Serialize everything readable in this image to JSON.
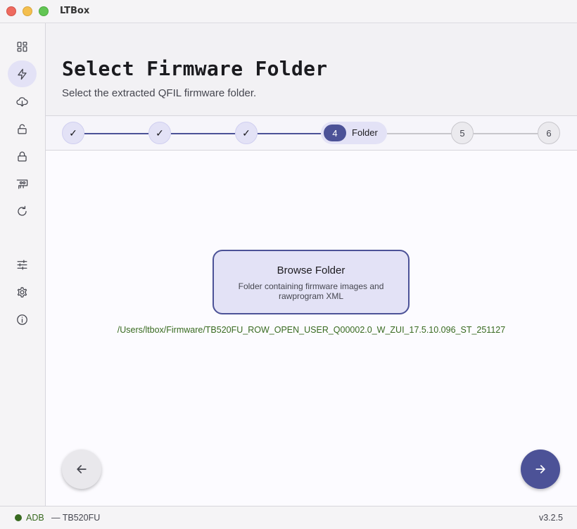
{
  "window": {
    "title": "LTBox"
  },
  "sidebar": {
    "items": [
      {
        "icon": "dashboard-icon",
        "active": false
      },
      {
        "icon": "lightning-icon",
        "active": true
      },
      {
        "icon": "cloud-download-icon",
        "active": false
      },
      {
        "icon": "unlock-icon",
        "active": false
      },
      {
        "icon": "lock-icon",
        "active": false
      },
      {
        "icon": "device-icon",
        "active": false
      },
      {
        "icon": "refresh-icon",
        "active": false
      },
      {
        "icon": "sliders-icon",
        "active": false
      },
      {
        "icon": "gear-icon",
        "active": false
      },
      {
        "icon": "info-icon",
        "active": false
      }
    ]
  },
  "header": {
    "title": "Select Firmware Folder",
    "subtitle": "Select the extracted QFIL firmware folder."
  },
  "stepper": {
    "steps": [
      {
        "mark": "✓",
        "state": "done"
      },
      {
        "mark": "✓",
        "state": "done"
      },
      {
        "mark": "✓",
        "state": "done"
      },
      {
        "mark": "4",
        "label": "Folder",
        "state": "current"
      },
      {
        "mark": "5",
        "state": "todo"
      },
      {
        "mark": "6",
        "state": "todo"
      }
    ]
  },
  "main": {
    "browse": {
      "title": "Browse Folder",
      "description": "Folder containing firmware images and rawprogram XML"
    },
    "selected_path": "/Users/ltbox/Firmware/TB520FU_ROW_OPEN_USER_Q00002.0_W_ZUI_17.5.10.096_ST_251127"
  },
  "status": {
    "connection": "ADB",
    "device": "— TB520FU",
    "version": "v3.2.5"
  },
  "colors": {
    "accent": "#4c5297",
    "accent_container": "#e3e2f6",
    "success": "#386a20"
  }
}
